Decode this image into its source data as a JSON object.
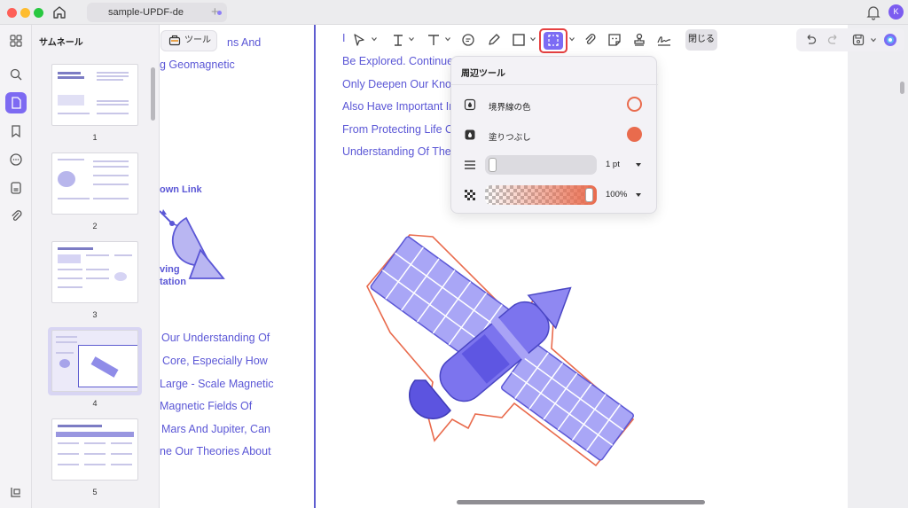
{
  "window": {
    "tab_title": "sample-UPDF-de",
    "avatar_letter": "K"
  },
  "sidebar": {
    "panel_title": "サムネール",
    "thumbnails": [
      {
        "page": "1"
      },
      {
        "page": "2"
      },
      {
        "page": "3"
      },
      {
        "page": "4",
        "selected": true
      },
      {
        "page": "5"
      }
    ]
  },
  "tool_pill": {
    "label": "ツール"
  },
  "toolbar": {
    "close_label": "閉じる",
    "active_tool": "area-shape-tool"
  },
  "popup": {
    "title": "周辺ツール",
    "border_color_label": "境界線の色",
    "fill_label": "塗りつぶし",
    "border_color": "#e96b4d",
    "fill_color": "#e96b4d",
    "thickness_value": "1 pt",
    "opacity_value": "100%"
  },
  "document": {
    "left_column": [
      "ns And",
      "g Geomagnetic",
      "own Link",
      "ving",
      "tation",
      "Our Understanding Of",
      "Core, Especially How",
      "Large - Scale Magnetic",
      "Magnetic Fields Of",
      "Mars And Jupiter, Can",
      "ne Our Theories About"
    ],
    "right_column": [
      "Be Explored. Continued",
      "Only Deepen Our Know",
      "Also Have Important Im",
      "From Protecting Life O",
      "Understanding Of The"
    ]
  },
  "colors": {
    "accent": "#7d6af2",
    "doc_text": "#5b57d6",
    "annotation": "#e96b4d"
  }
}
